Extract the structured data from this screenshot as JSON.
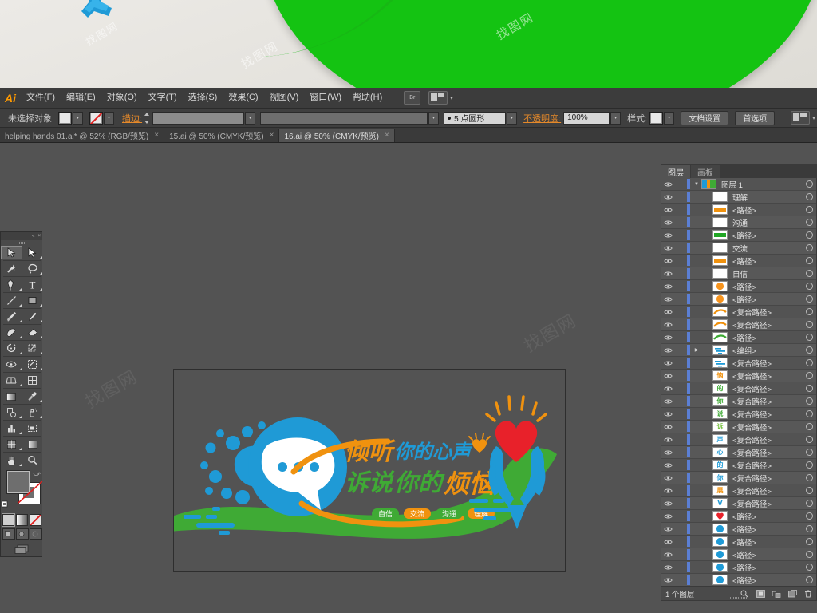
{
  "banner": {
    "watermark": "找图网"
  },
  "app": {
    "name": "Ai",
    "menu": [
      "文件(F)",
      "编辑(E)",
      "对象(O)",
      "文字(T)",
      "选择(S)",
      "效果(C)",
      "视图(V)",
      "窗口(W)",
      "帮助(H)"
    ],
    "bridge_button": "Br",
    "arrange_caret": "▾"
  },
  "control_bar": {
    "selection_status": "未选择对象",
    "fill_swatch_color": "#e8e8e8",
    "stroke_swatch": "none",
    "stroke_label": "描边:",
    "stroke_weight_value": "",
    "stroke_profile_value": "",
    "brush_definition": "5 点圆形",
    "opacity_label": "不透明度:",
    "opacity_value": "100%",
    "style_label": "样式:",
    "doc_setup_button": "文档设置",
    "preferences_button": "首选项",
    "extra_caret": "▾"
  },
  "tabs": [
    {
      "label": "helping hands 01.ai* @ 52% (RGB/预览)",
      "close": "×",
      "active": false
    },
    {
      "label": "15.ai @ 50% (CMYK/预览)",
      "close": "×",
      "active": false
    },
    {
      "label": "16.ai @ 50% (CMYK/预览)",
      "close": "×",
      "active": true
    }
  ],
  "toolbar": {
    "collapse_icon": "«",
    "close_icon": "×",
    "tools": [
      "selection-tool",
      "direct-selection-tool",
      "magic-wand-tool",
      "lasso-tool",
      "pen-tool",
      "type-tool",
      "line-segment-tool",
      "rectangle-tool",
      "paintbrush-tool",
      "pencil-tool",
      "blob-brush-tool",
      "eraser-tool",
      "rotate-tool",
      "scale-tool",
      "width-tool",
      "shape-builder-tool",
      "perspective-grid-tool",
      "mesh-tool",
      "gradient-tool",
      "eyedropper-tool",
      "blend-tool",
      "symbol-sprayer-tool",
      "column-graph-tool",
      "artboard-tool",
      "slice-tool",
      "hand-tool",
      "zoom-tool"
    ],
    "fill_color": "#6e6e6e",
    "stroke_color": "#ffffff",
    "draw_modes": [
      "draw-normal",
      "draw-behind",
      "draw-inside"
    ],
    "screen_mode": "change-screen-mode"
  },
  "artwork": {
    "headline_line1_orange": "倾听",
    "headline_line1_blue": "你的心声",
    "headline_line2_orange_prefix": "诉说",
    "headline_line2_blue": "你的",
    "headline_line2_orange_suffix": "烦恼",
    "tags": [
      {
        "label": "自信",
        "color": "#3faa35"
      },
      {
        "label": "交流",
        "color": "#f0920f"
      },
      {
        "label": "沟通",
        "color": "#3faa35"
      },
      {
        "label": "理解",
        "color": "#f0920f"
      }
    ],
    "colors": {
      "blue": "#1f9ad6",
      "green": "#3faa35",
      "orange": "#f0920f",
      "red": "#e8212a",
      "white": "#ffffff",
      "canvas": "#535353"
    }
  },
  "layers_panel": {
    "tabs": [
      {
        "label": "图层",
        "active": true
      },
      {
        "label": "画板",
        "active": false
      }
    ],
    "rows": [
      {
        "name": "图层 1",
        "kind": "layer",
        "expanded": true,
        "thumb": "artwork",
        "indent": 0
      },
      {
        "name": "理解",
        "kind": "text",
        "thumb": "#ffffff",
        "indent": 1
      },
      {
        "name": "<路径>",
        "kind": "path",
        "thumb": "#f0920f",
        "indent": 1
      },
      {
        "name": "沟通",
        "kind": "text",
        "thumb": "#ffffff",
        "indent": 1
      },
      {
        "name": "<路径>",
        "kind": "path",
        "thumb": "#22a726",
        "indent": 1
      },
      {
        "name": "交流",
        "kind": "text",
        "thumb": "#ffffff",
        "indent": 1
      },
      {
        "name": "<路径>",
        "kind": "path",
        "thumb": "#f0920f",
        "indent": 1
      },
      {
        "name": "自信",
        "kind": "text",
        "thumb": "#ffffff",
        "indent": 1
      },
      {
        "name": "<路径>",
        "kind": "path",
        "thumb": "#f7941e",
        "shape": "circle",
        "indent": 1
      },
      {
        "name": "<路径>",
        "kind": "path",
        "thumb": "#f7941e",
        "shape": "circle",
        "indent": 1
      },
      {
        "name": "<复合路径>",
        "kind": "compound",
        "thumb": "#f0920f",
        "shape": "swoosh",
        "indent": 1
      },
      {
        "name": "<复合路径>",
        "kind": "compound",
        "thumb": "#f0920f",
        "shape": "swoosh",
        "indent": 1
      },
      {
        "name": "<路径>",
        "kind": "path",
        "thumb": "#3faa35",
        "shape": "swoosh",
        "indent": 1
      },
      {
        "name": "<编组>",
        "kind": "group",
        "expanded": false,
        "thumb": "#1f9ad6",
        "shape": "lines",
        "indent": 1
      },
      {
        "name": "<复合路径>",
        "kind": "compound",
        "thumb": "#1f9ad6",
        "shape": "lines",
        "indent": 1
      },
      {
        "name": "<复合路径>",
        "kind": "compound",
        "thumb": "#f0920f",
        "glyph": "恼",
        "indent": 1
      },
      {
        "name": "<复合路径>",
        "kind": "compound",
        "thumb": "#3faa35",
        "glyph": "的",
        "indent": 1
      },
      {
        "name": "<复合路径>",
        "kind": "compound",
        "thumb": "#3faa35",
        "glyph": "你",
        "indent": 1
      },
      {
        "name": "<复合路径>",
        "kind": "compound",
        "thumb": "#3faa35",
        "glyph": "说",
        "indent": 1
      },
      {
        "name": "<复合路径>",
        "kind": "compound",
        "thumb": "#7ac143",
        "glyph": "诉",
        "indent": 1
      },
      {
        "name": "<复合路径>",
        "kind": "compound",
        "thumb": "#1f9ad6",
        "glyph": "声",
        "indent": 1
      },
      {
        "name": "<复合路径>",
        "kind": "compound",
        "thumb": "#1f9ad6",
        "glyph": "心",
        "indent": 1
      },
      {
        "name": "<复合路径>",
        "kind": "compound",
        "thumb": "#1f9ad6",
        "glyph": "的",
        "indent": 1
      },
      {
        "name": "<复合路径>",
        "kind": "compound",
        "thumb": "#1f9ad6",
        "glyph": "你",
        "indent": 1
      },
      {
        "name": "<复合路径>",
        "kind": "compound",
        "thumb": "#f0920f",
        "glyph": "展",
        "indent": 1
      },
      {
        "name": "<复合路径>",
        "kind": "compound",
        "thumb": "#1f9ad6",
        "glyph": "V",
        "indent": 1
      },
      {
        "name": "<路径>",
        "kind": "path",
        "thumb": "#e8212a",
        "shape": "heart",
        "indent": 1
      },
      {
        "name": "<路径>",
        "kind": "path",
        "thumb": "#1f9ad6",
        "shape": "circle",
        "indent": 1
      },
      {
        "name": "<路径>",
        "kind": "path",
        "thumb": "#1f9ad6",
        "shape": "circle",
        "indent": 1
      },
      {
        "name": "<路径>",
        "kind": "path",
        "thumb": "#1f9ad6",
        "shape": "circle",
        "indent": 1
      },
      {
        "name": "<路径>",
        "kind": "path",
        "thumb": "#1f9ad6",
        "shape": "circle",
        "indent": 1
      },
      {
        "name": "<路径>",
        "kind": "path",
        "thumb": "#1f9ad6",
        "shape": "circle",
        "indent": 1
      },
      {
        "name": "<路径>",
        "kind": "path",
        "thumb": "#1f9ad6",
        "shape": "circle",
        "indent": 1
      }
    ],
    "footer_count": "1 个图层",
    "footer_icons": [
      "locate-object-icon",
      "make-clipping-mask-icon",
      "create-sublayer-icon",
      "new-layer-icon",
      "delete-layer-icon"
    ]
  }
}
